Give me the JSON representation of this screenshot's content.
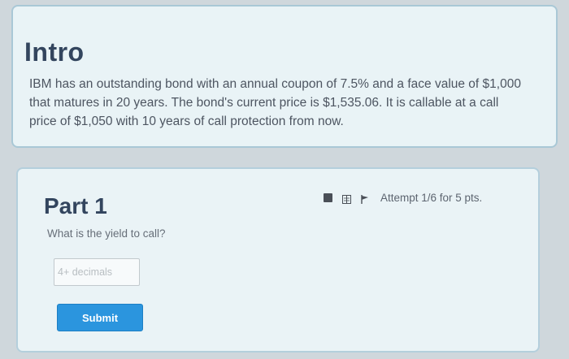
{
  "intro": {
    "title": "Intro",
    "text": "IBM has an outstanding bond with an annual coupon of 7.5% and a face value of $1,000 that matures in 20 years. The bond's current price is $1,535.06. It is callable at a call price of $1,050 with 10 years of call protection from now."
  },
  "part": {
    "title": "Part 1",
    "attempt": "Attempt 1/6 for 5 pts.",
    "question": "What is the yield to call?",
    "answer": {
      "value": "",
      "placeholder": "4+ decimals"
    },
    "submit_label": "Submit"
  },
  "toolbar": {
    "icons": [
      "calculator-icon",
      "book-icon",
      "flag-icon"
    ]
  },
  "colors": {
    "page_background": "#cfd7dc",
    "card_background": "#e9f3f6",
    "card_border": "#a9c8d6",
    "heading": "#33455e",
    "submit_button": "#2b95de"
  }
}
